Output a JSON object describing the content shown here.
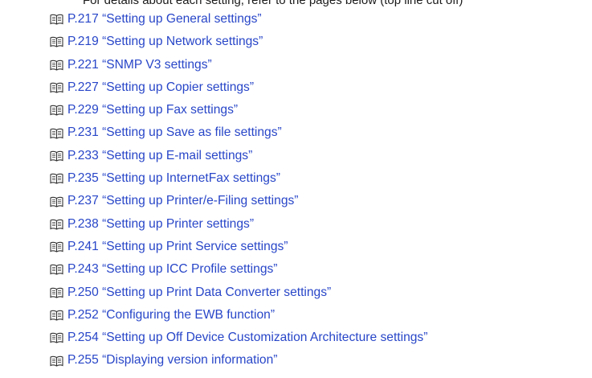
{
  "header": {
    "clipped_text": "For details about each setting, refer to the pages below (top line cut off)"
  },
  "references": {
    "icon": "book-reference-icon",
    "link_color": "#2846c8",
    "items": [
      {
        "label": "P.217 “Setting up General settings”"
      },
      {
        "label": "P.219 “Setting up Network settings”"
      },
      {
        "label": "P.221 “SNMP V3 settings”"
      },
      {
        "label": "P.227 “Setting up Copier settings”"
      },
      {
        "label": "P.229 “Setting up Fax settings”"
      },
      {
        "label": "P.231 “Setting up Save as file settings”"
      },
      {
        "label": "P.233 “Setting up E-mail settings”"
      },
      {
        "label": "P.235 “Setting up InternetFax settings”"
      },
      {
        "label": "P.237 “Setting up Printer/e-Filing settings”"
      },
      {
        "label": "P.238 “Setting up Printer settings”"
      },
      {
        "label": "P.241 “Setting up Print Service settings”"
      },
      {
        "label": "P.243 “Setting up ICC Profile settings”"
      },
      {
        "label": "P.250 “Setting up Print Data Converter settings”"
      },
      {
        "label": "P.252 “Configuring the EWB function”"
      },
      {
        "label": "P.254 “Setting up Off Device Customization Architecture settings”"
      },
      {
        "label": "P.255 “Displaying version information”"
      }
    ]
  }
}
